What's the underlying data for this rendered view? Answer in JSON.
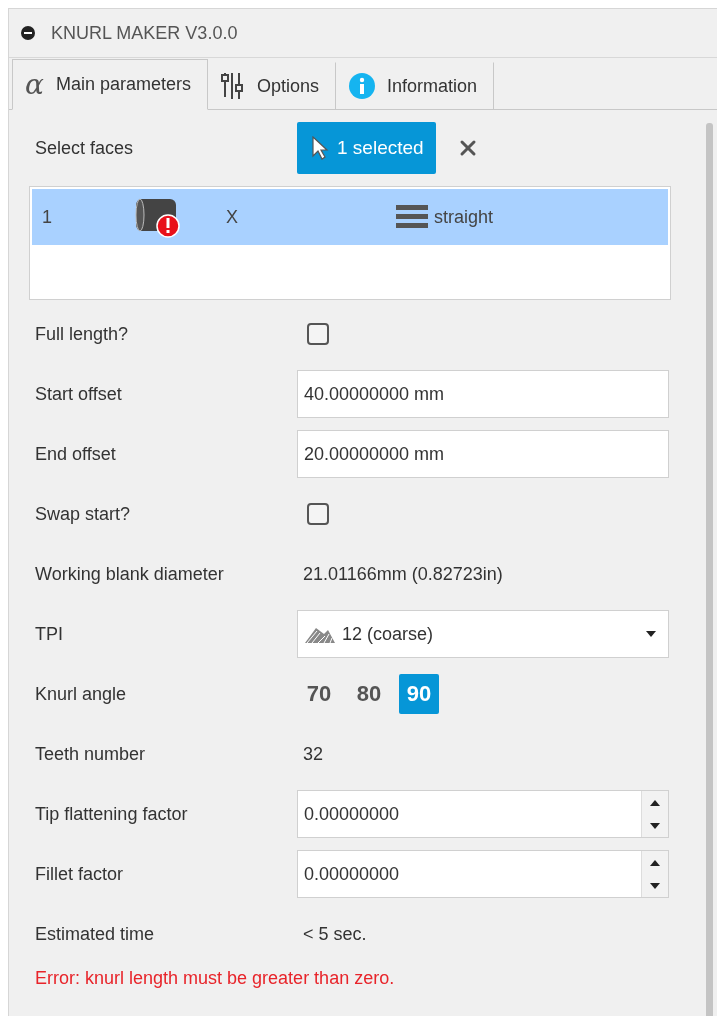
{
  "window": {
    "title": "KNURL MAKER V3.0.0"
  },
  "tabs": [
    {
      "label": "Main parameters",
      "kind": "formula",
      "glyph": "α",
      "selected": true
    },
    {
      "label": "Options",
      "kind": "options",
      "selected": false
    },
    {
      "label": "Information",
      "kind": "info",
      "selected": false
    }
  ],
  "selection": {
    "label": "Select faces",
    "button": "1 selected"
  },
  "faces": [
    {
      "index": "1",
      "axis": "X",
      "pattern": "straight",
      "error": true,
      "selected": true
    }
  ],
  "rows": [
    {
      "kind": "checkbox",
      "label": "Full length?",
      "checked": false
    },
    {
      "kind": "text",
      "label": "Start offset",
      "value": "40.00000000 mm"
    },
    {
      "kind": "text",
      "label": "End offset",
      "value": "20.00000000 mm"
    },
    {
      "kind": "checkbox",
      "label": "Swap start?",
      "checked": false
    },
    {
      "kind": "value",
      "label": "Working blank diameter",
      "value": "21.01166mm (0.82723in)"
    },
    {
      "kind": "dropdown",
      "label": "TPI",
      "value": "12 (coarse)"
    },
    {
      "kind": "choice",
      "label": "Knurl angle",
      "options": [
        {
          "label": "70",
          "selected": false
        },
        {
          "label": "80",
          "selected": false
        },
        {
          "label": "90",
          "selected": true
        }
      ]
    },
    {
      "kind": "value",
      "label": "Teeth number",
      "value": "32"
    },
    {
      "kind": "spin",
      "label": "Tip flattening factor",
      "value": "0.00000000"
    },
    {
      "kind": "spin",
      "label": "Fillet factor",
      "value": "0.00000000"
    },
    {
      "kind": "value",
      "label": "Estimated time",
      "value": "< 5 sec."
    }
  ],
  "error": "Error: knurl length must be greater than zero."
}
